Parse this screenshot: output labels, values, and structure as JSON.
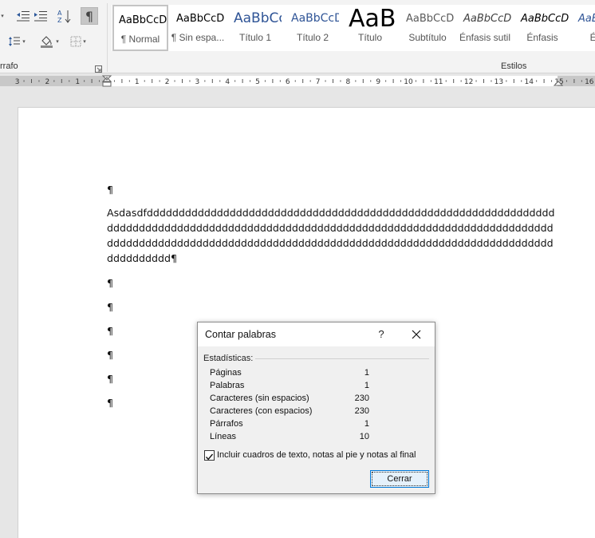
{
  "ribbon": {
    "paragraph_group_label": "rrafo",
    "styles_group_label": "Estilos",
    "pilcrow_glyph": "¶",
    "styles": [
      {
        "preview": "AaBbCcDc",
        "name": "¶ Normal",
        "selected": true,
        "color": "#000000"
      },
      {
        "preview": "AaBbCcDc",
        "name": "¶ Sin espa...",
        "selected": false,
        "color": "#000000"
      },
      {
        "preview": "AaBbCc",
        "name": "Título 1",
        "selected": false,
        "color": "#2f5496"
      },
      {
        "preview": "AaBbCcD",
        "name": "Título 2",
        "selected": false,
        "color": "#2f5496"
      },
      {
        "preview": "AaB",
        "name": "Título",
        "selected": false,
        "color": "#000000"
      },
      {
        "preview": "AaBbCcD",
        "name": "Subtítulo",
        "selected": false,
        "color": "#5a5a5a"
      },
      {
        "preview": "AaBbCcDc",
        "name": "Énfasis sutil",
        "selected": false,
        "color": "#404040"
      },
      {
        "preview": "AaBbCcDc",
        "name": "Énfasis",
        "selected": false,
        "color": "#000000"
      },
      {
        "preview": "AaBbCc",
        "name": "Énfa",
        "selected": false,
        "color": "#2f5496"
      }
    ]
  },
  "ruler": {
    "left_labels": [
      "3",
      "2",
      "1"
    ],
    "right_labels": [
      "1",
      "2",
      "3",
      "4",
      "5",
      "6",
      "7",
      "8",
      "9",
      "10",
      "11",
      "12",
      "13",
      "14",
      "15",
      "16"
    ]
  },
  "document": {
    "lines": [
      "¶",
      "Asdasdfdddddddddddddddddddddddddddddddddddddddddddddddddddddddddddddddd",
      "dddddddddddddddddddddddddddddddddddddddddddddddddddddddddddddddddddddd",
      "dddddddddddddddddddddddddddddddddddddddddddddddddddddddddddddddddddddd",
      "dddddddddd¶",
      "¶",
      "¶",
      "¶",
      "¶",
      "¶",
      "¶"
    ]
  },
  "dialog": {
    "title": "Contar palabras",
    "help": "?",
    "group_label": "Estadísticas:",
    "stats": [
      {
        "label": "Páginas",
        "value": "1"
      },
      {
        "label": "Palabras",
        "value": "1"
      },
      {
        "label": "Caracteres (sin espacios)",
        "value": "230"
      },
      {
        "label": "Caracteres (con espacios)",
        "value": "230"
      },
      {
        "label": "Párrafos",
        "value": "1"
      },
      {
        "label": "Líneas",
        "value": "10"
      }
    ],
    "checkbox_label": "Incluir cuadros de texto, notas al pie y notas al final",
    "checkbox_checked": true,
    "close_button": "Cerrar"
  }
}
